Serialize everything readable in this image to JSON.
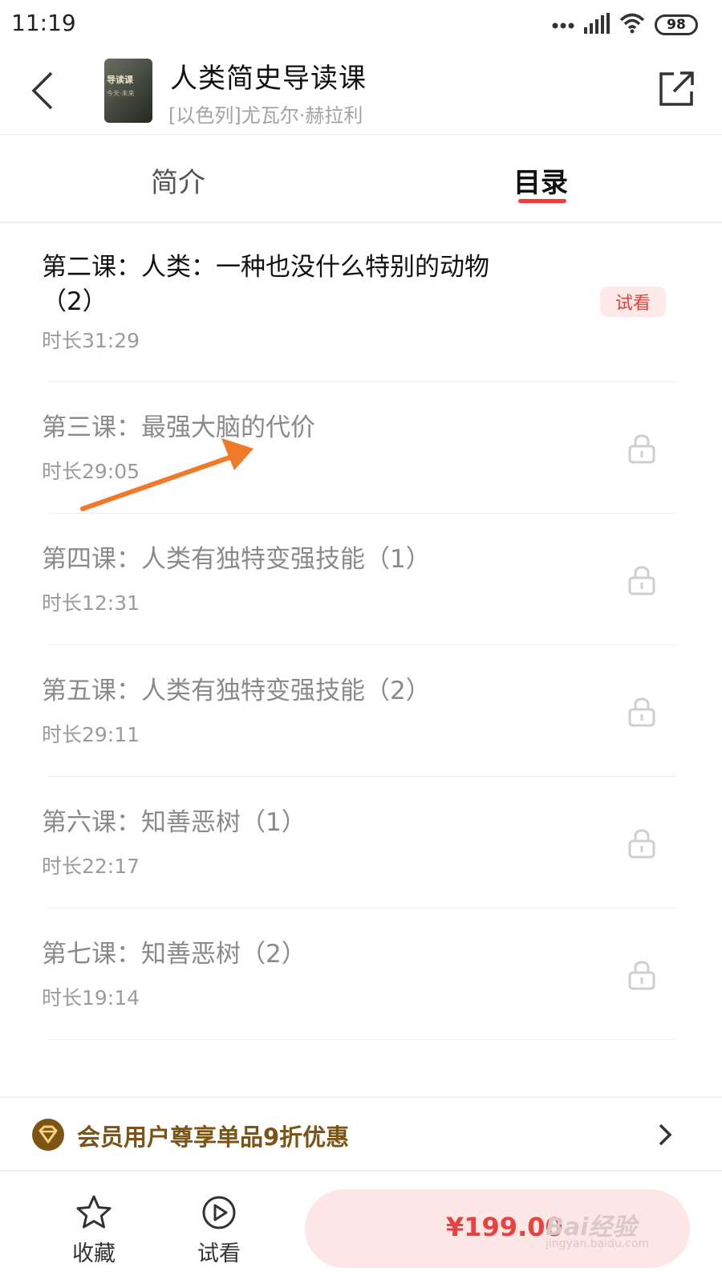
{
  "status_bar": {
    "time": "11:19",
    "battery": "98"
  },
  "header": {
    "title": "人类简史导读课",
    "author": "[以色列]尤瓦尔·赫拉利",
    "cover_text": "导读课",
    "cover_sub": "今天·未来"
  },
  "tabs": [
    {
      "label": "简介",
      "active": false
    },
    {
      "label": "目录",
      "active": true
    }
  ],
  "lessons": [
    {
      "title": "第二课：人类：一种也没什么特别的动物（2）",
      "duration": "时长31:29",
      "tag": "试看",
      "locked": false
    },
    {
      "title": "第三课：最强大脑的代价",
      "duration": "时长29:05",
      "locked": true
    },
    {
      "title": "第四课：人类有独特变强技能（1）",
      "duration": "时长12:31",
      "locked": true
    },
    {
      "title": "第五课：人类有独特变强技能（2）",
      "duration": "时长29:11",
      "locked": true
    },
    {
      "title": "第六课：知善恶树（1）",
      "duration": "时长22:17",
      "locked": true
    },
    {
      "title": "第七课：知善恶树（2）",
      "duration": "时长19:14",
      "locked": true
    }
  ],
  "member_banner": {
    "text": "会员用户尊享单品9折优惠"
  },
  "bottom_bar": {
    "favorite_label": "收藏",
    "preview_label": "试看",
    "price": "¥199.00"
  },
  "watermark": {
    "text": "Bai经验",
    "sub": "jingyan.baidu.com"
  },
  "colors": {
    "accent": "#e8413f",
    "member_gold": "#7b5416",
    "tag_bg": "#fde9e8"
  },
  "icons": [
    "back-arrow-icon",
    "share-icon",
    "lock-icon",
    "member-diamond-icon",
    "chevron-right-icon",
    "star-icon",
    "play-circle-icon",
    "wifi-icon",
    "signal-icon"
  ]
}
